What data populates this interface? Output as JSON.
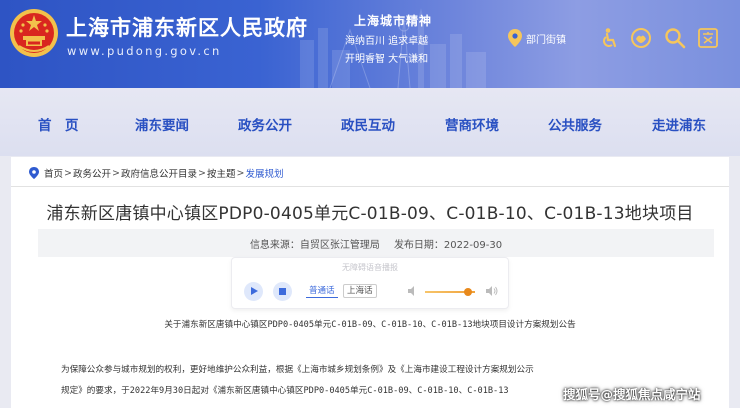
{
  "header": {
    "site_title": "上海市浦东新区人民政府",
    "site_domain": "www.pudong.gov.cn",
    "spirit_title": "上海城市精神",
    "spirit_line1": "海纳百川  追求卓越",
    "spirit_line2": "开明睿智  大气谦和",
    "dept_nav_label": "部门街镇",
    "icons": [
      "location-pin-icon",
      "accessibility-icon",
      "elder-care-icon",
      "search-icon",
      "language-icon"
    ]
  },
  "nav": {
    "items": [
      "首　页",
      "浦东要闻",
      "政务公开",
      "政民互动",
      "营商环境",
      "公共服务",
      "走进浦东"
    ]
  },
  "breadcrumb": {
    "items": [
      "首页",
      "政务公开",
      "政府信息公开目录",
      "按主题"
    ],
    "current": "发展规划",
    "separator": ">"
  },
  "article": {
    "title": "浦东新区唐镇中心镇区PDP0-0405单元C-01B-09、C-01B-10、C-01B-13地块项目",
    "source": "信息来源：自贸区张江管理局",
    "date": "发布日期：2022-09-30",
    "notice": "关于浦东新区唐镇中心镇区PDP0-0405单元C-01B-09、C-01B-10、C-01B-13地块项目设计方案规划公告",
    "para1": "为保障公众参与城市规划的权利，更好地维护公众利益，根据《上海市城乡规划条例》及《上海市建设工程设计方案规划公示",
    "para2": "规定》的要求，于2022年9月30日起对《浦东新区唐镇中心镇区PDP0-0405单元C-01B-09、C-01B-10、C-01B-13"
  },
  "player": {
    "notice": "无障碍语音播报",
    "lang_standard": "普通话",
    "lang_local": "上海话",
    "volume_level": 0.85,
    "accent_color": "#3d6bdc"
  },
  "watermark": "搜狐号@搜狐焦点咸宁站",
  "colors": {
    "header_blue": "#2e54c4",
    "nav_text": "#2950c2",
    "link_current": "#2f5bd0"
  }
}
